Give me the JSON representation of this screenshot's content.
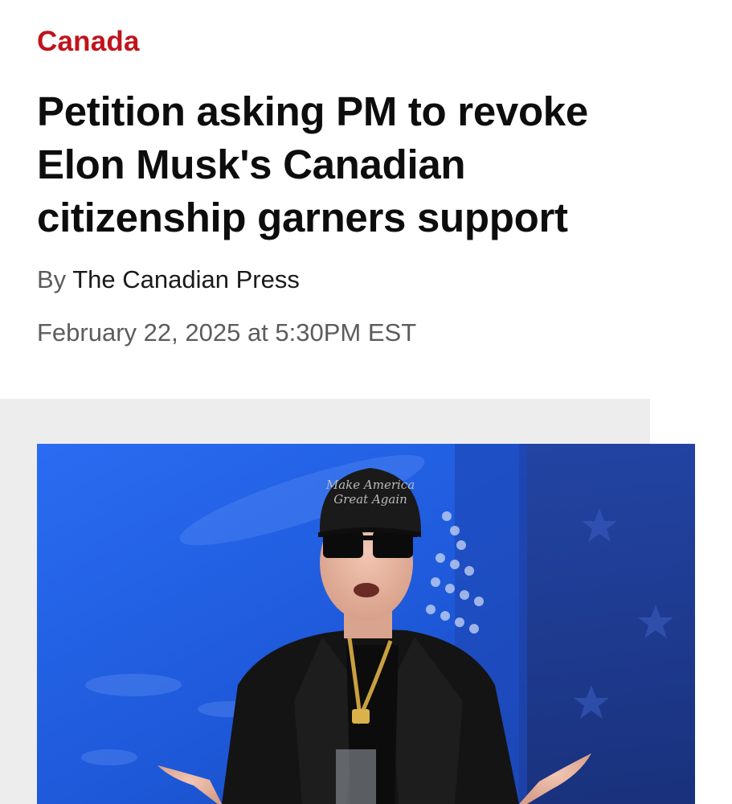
{
  "article": {
    "section": "Canada",
    "headline": "Petition asking PM to revoke Elon Musk's Canadian citizenship garners support",
    "byline_prefix": "By",
    "author": "The Canadian Press",
    "date": "February 22, 2025 at 5:30PM EST"
  },
  "photo": {
    "cap_text_line1": "Make America",
    "cap_text_line2": "Great Again"
  },
  "colors": {
    "section_red": "#c0141b",
    "photo_blue": "#1f5fe0",
    "media_background": "#ededed"
  }
}
